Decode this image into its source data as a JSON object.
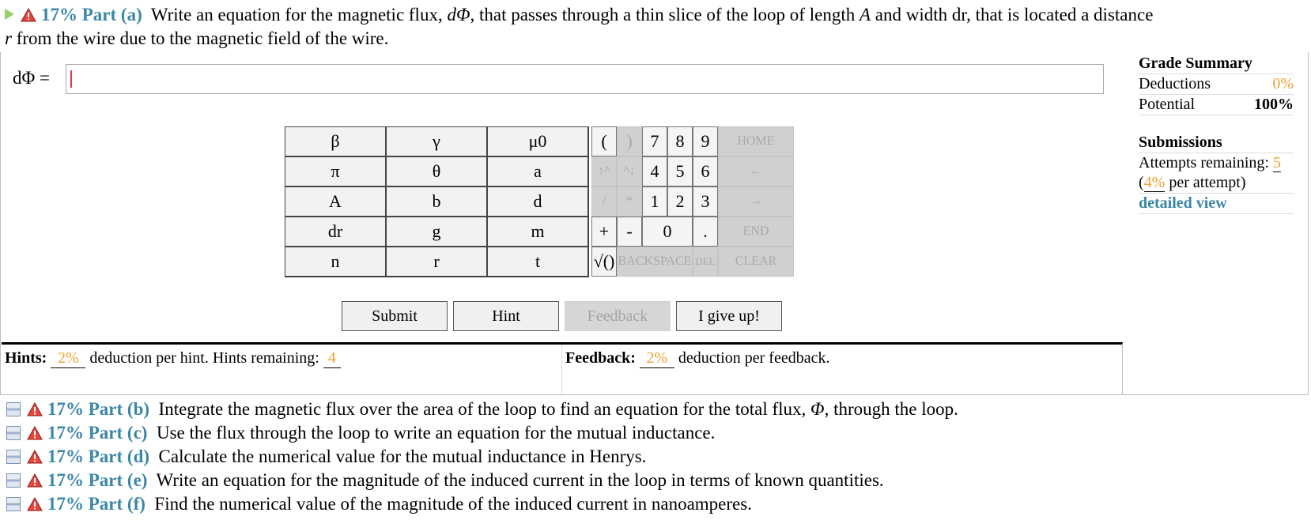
{
  "part_a": {
    "percent": "17%",
    "label": "Part (a)",
    "text_1": "Write an equation for the magnetic flux, ",
    "symbol": "dΦ",
    "text_2": ", that passes through a thin slice of the loop of length ",
    "var_A": "A",
    "text_3": " and width dr, that is located a distance",
    "var_r": "r",
    "text_4": " from the wire due to the magnetic field of the wire."
  },
  "answer": {
    "label": "dΦ =",
    "value": ""
  },
  "grade_summary": {
    "title": "Grade Summary",
    "deductions_label": "Deductions",
    "deductions_value": "0%",
    "potential_label": "Potential",
    "potential_value": "100%",
    "submissions_title": "Submissions",
    "attempts_label": "Attempts remaining:",
    "attempts_value": "5",
    "per_attempt_value": "4%",
    "per_attempt_text": " per attempt)",
    "detailed_view": "detailed view"
  },
  "symbols": [
    "β",
    "γ",
    "μ0",
    "π",
    "θ",
    "a",
    "A",
    "b",
    "d",
    "dr",
    "g",
    "m",
    "n",
    "r",
    "t"
  ],
  "keypad": {
    "open_paren": "(",
    "close_paren": ")",
    "seven": "7",
    "eight": "8",
    "nine": "9",
    "home": "HOME",
    "up_caret": "↑^",
    "down_caret": "^↓",
    "four": "4",
    "five": "5",
    "six": "6",
    "left": "←",
    "slash": "/",
    "star": "*",
    "one": "1",
    "two": "2",
    "three": "3",
    "right": "→",
    "plus": "+",
    "minus": "-",
    "zero": "0",
    "dot": ".",
    "end": "END",
    "sqrt": "√()",
    "backspace": "BACKSPACE",
    "del": "DEL",
    "clear": "CLEAR"
  },
  "buttons": {
    "submit": "Submit",
    "hint": "Hint",
    "feedback": "Feedback",
    "give_up": "I give up!"
  },
  "hints": {
    "label": "Hints:",
    "deduction": "2%",
    "text": " deduction per hint. Hints remaining: ",
    "remaining": "4"
  },
  "feedback": {
    "label": "Feedback:",
    "deduction": "2%",
    "text": " deduction per feedback."
  },
  "parts": [
    {
      "percent": "17%",
      "label": "Part (b)",
      "text": "Integrate the magnetic flux over the area of the loop to find an equation for the total flux, ",
      "sym": "Φ",
      "tail": ", through the loop."
    },
    {
      "percent": "17%",
      "label": "Part (c)",
      "text": "Use the flux through the loop to write an equation for the mutual inductance.",
      "sym": "",
      "tail": ""
    },
    {
      "percent": "17%",
      "label": "Part (d)",
      "text": "Calculate the numerical value for the mutual inductance in Henrys.",
      "sym": "",
      "tail": ""
    },
    {
      "percent": "17%",
      "label": "Part (e)",
      "text": "Write an equation for the magnitude of the induced current in the loop in terms of known quantities.",
      "sym": "",
      "tail": ""
    },
    {
      "percent": "17%",
      "label": "Part (f)",
      "text": "Find the numerical value of the magnitude of the induced current in nanoamperes.",
      "sym": "",
      "tail": ""
    }
  ]
}
